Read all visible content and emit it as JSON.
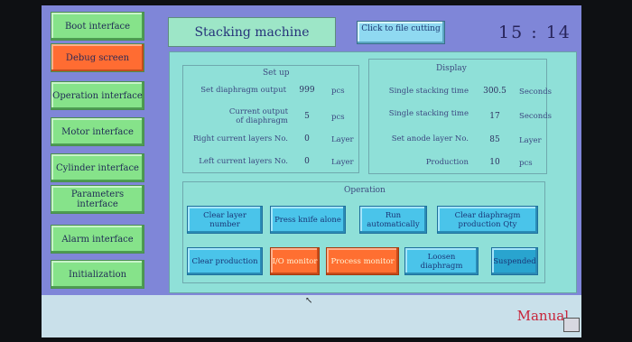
{
  "nav": {
    "boot": "Boot interface",
    "debug": "Debug screen",
    "operation": "Operation interface",
    "motor": "Motor interface",
    "cylinder": "Cylinder interface",
    "parameters": "Parameters interface",
    "alarm": "Alarm interface",
    "initialization": "Initialization"
  },
  "header": {
    "title": "Stacking machine",
    "file_btn": "Click to file cutting",
    "clock_hour": "15",
    "clock_sep": ":",
    "clock_minute": "14"
  },
  "setup": {
    "title": "Set up",
    "rows": [
      {
        "label": "Set diaphragm output",
        "value": "999",
        "unit": "pcs"
      },
      {
        "label": "Current output of diaphragm",
        "value": "5",
        "unit": "pcs"
      },
      {
        "label": "Right current layers No.",
        "value": "0",
        "unit": "Layer"
      },
      {
        "label": "Left current layers No.",
        "value": "0",
        "unit": "Layer"
      }
    ]
  },
  "display": {
    "title": "Display",
    "rows": [
      {
        "label": "Single stacking time",
        "value": "300.5",
        "unit": "Seconds"
      },
      {
        "label": "Single stacking time",
        "value": "17",
        "unit": "Seconds"
      },
      {
        "label": "Set anode layer No.",
        "value": "85",
        "unit": "Layer"
      },
      {
        "label": "Production",
        "value": "10",
        "unit": "pcs"
      }
    ]
  },
  "operation": {
    "title": "Operation",
    "clear_layer": "Clear layer number",
    "press_knife": "Press knife alone",
    "run_auto": "Run automatically",
    "clear_diaphragm": "Clear diaphragm production Qty",
    "clear_production": "Clear production",
    "io_monitor": "I/O monitor",
    "process_monitor": "Process monitor",
    "loosen_diaphragm": "Loosen diaphragm",
    "suspended": "Suspended"
  },
  "status": {
    "mode": "Manual"
  }
}
